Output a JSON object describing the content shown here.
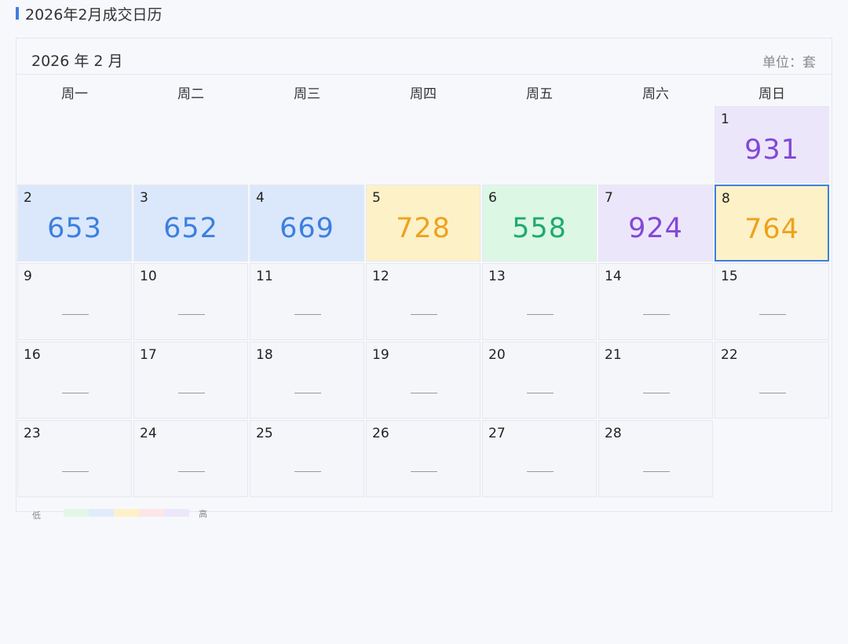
{
  "page": {
    "title": "2026年2月成交日历"
  },
  "calendar": {
    "month_label": "2026 年 2 月",
    "unit_label": "单位：套",
    "weekdays": [
      "周一",
      "周二",
      "周三",
      "周四",
      "周五",
      "周六",
      "周日"
    ],
    "leading_blank_days": 6,
    "selected_day": 8,
    "days": [
      {
        "day": "1",
        "value": "931",
        "level": "purple"
      },
      {
        "day": "2",
        "value": "653",
        "level": "blue"
      },
      {
        "day": "3",
        "value": "652",
        "level": "blue"
      },
      {
        "day": "4",
        "value": "669",
        "level": "blue"
      },
      {
        "day": "5",
        "value": "728",
        "level": "yellow"
      },
      {
        "day": "6",
        "value": "558",
        "level": "green"
      },
      {
        "day": "7",
        "value": "924",
        "level": "purple"
      },
      {
        "day": "8",
        "value": "764",
        "level": "yellow"
      },
      {
        "day": "9",
        "value": null,
        "level": "none"
      },
      {
        "day": "10",
        "value": null,
        "level": "none"
      },
      {
        "day": "11",
        "value": null,
        "level": "none"
      },
      {
        "day": "12",
        "value": null,
        "level": "none"
      },
      {
        "day": "13",
        "value": null,
        "level": "none"
      },
      {
        "day": "14",
        "value": null,
        "level": "none"
      },
      {
        "day": "15",
        "value": null,
        "level": "none"
      },
      {
        "day": "16",
        "value": null,
        "level": "none"
      },
      {
        "day": "17",
        "value": null,
        "level": "none"
      },
      {
        "day": "18",
        "value": null,
        "level": "none"
      },
      {
        "day": "19",
        "value": null,
        "level": "none"
      },
      {
        "day": "20",
        "value": null,
        "level": "none"
      },
      {
        "day": "21",
        "value": null,
        "level": "none"
      },
      {
        "day": "22",
        "value": null,
        "level": "none"
      },
      {
        "day": "23",
        "value": null,
        "level": "none"
      },
      {
        "day": "24",
        "value": null,
        "level": "none"
      },
      {
        "day": "25",
        "value": null,
        "level": "none"
      },
      {
        "day": "26",
        "value": null,
        "level": "none"
      },
      {
        "day": "27",
        "value": null,
        "level": "none"
      },
      {
        "day": "28",
        "value": null,
        "level": "none"
      }
    ]
  },
  "legend": {
    "low_label": "低",
    "high_label": "高",
    "colors": [
      "#e2f8e6",
      "#e1ecfb",
      "#fdf1c9",
      "#fde6e8",
      "#ece7fb"
    ]
  },
  "colors": {
    "accent": "#3f7fe0",
    "levels": {
      "green": {
        "bg": "#dcf8e4",
        "fg": "#1faa6e"
      },
      "blue": {
        "bg": "#dbe8fc",
        "fg": "#3d7fe0"
      },
      "yellow": {
        "bg": "#fdf1c8",
        "fg": "#eda31c"
      },
      "red": {
        "bg": "#fde4e6",
        "fg": "#e05a5a"
      },
      "purple": {
        "bg": "#ece6fb",
        "fg": "#8447d8"
      }
    }
  }
}
